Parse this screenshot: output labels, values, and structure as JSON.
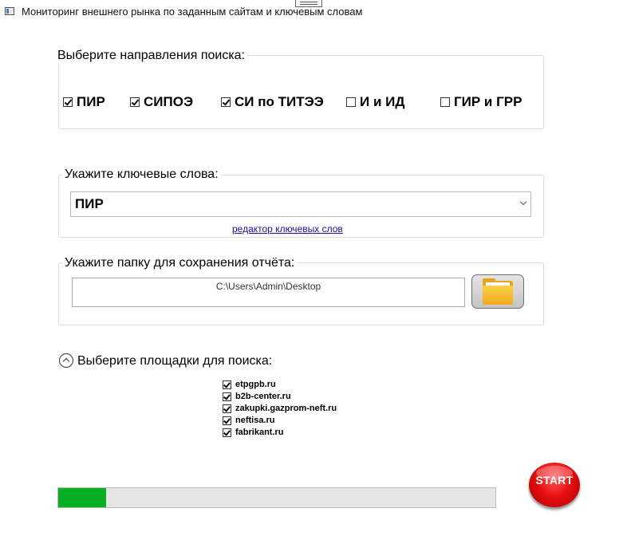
{
  "window": {
    "title": "Мониторинг внешнего рынка по заданным сайтам и ключевым словам"
  },
  "directions": {
    "label": "Выберите направления поиска:",
    "items": [
      {
        "label": "ПИР",
        "checked": true
      },
      {
        "label": "СИПОЭ",
        "checked": true
      },
      {
        "label": "СИ по ТИТЭЭ",
        "checked": true
      },
      {
        "label": "И и ИД",
        "checked": false
      },
      {
        "label": "ГИР и ГРР",
        "checked": false
      }
    ]
  },
  "keywords": {
    "label": "Укажите ключевые слова:",
    "selected": "ПИР",
    "editor_link": "редактор ключевых слов"
  },
  "folder": {
    "label": "Укажите папку для сохранения отчёта:",
    "path": "C:\\Users\\Admin\\Desktop",
    "browse_icon": "folder-icon"
  },
  "sites": {
    "label": "Выберите площадки для поиска:",
    "items": [
      {
        "label": "etpgpb.ru",
        "checked": true
      },
      {
        "label": "b2b-center.ru",
        "checked": true
      },
      {
        "label": "zakupki.gazprom-neft.ru",
        "checked": true
      },
      {
        "label": "neftisa.ru",
        "checked": true
      },
      {
        "label": "fabrikant.ru",
        "checked": true
      }
    ]
  },
  "progress": {
    "value": 0.11,
    "color": "#06b025"
  },
  "start": {
    "label": "START"
  }
}
